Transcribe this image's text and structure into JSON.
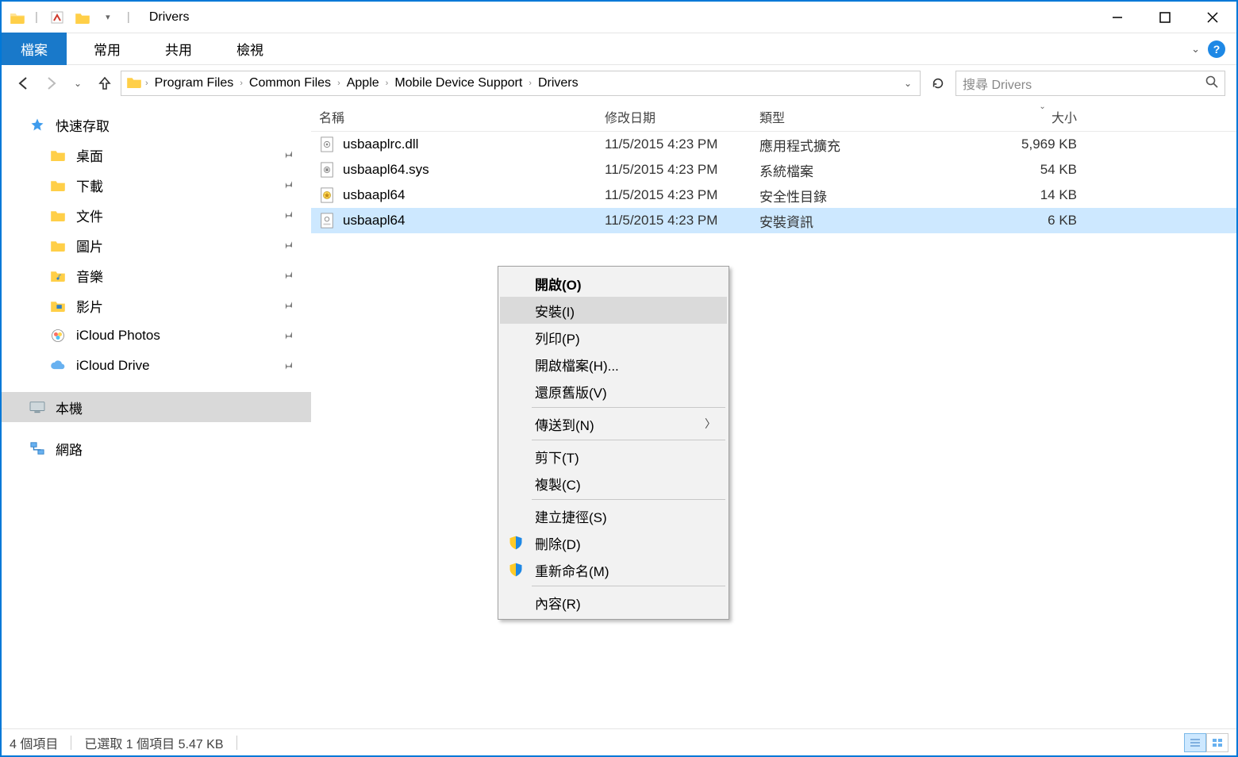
{
  "titlebar": {
    "title": "Drivers"
  },
  "ribbon": {
    "tabs": [
      "檔案",
      "常用",
      "共用",
      "檢視"
    ]
  },
  "breadcrumb": {
    "segments": [
      "Program Files",
      "Common Files",
      "Apple",
      "Mobile Device Support",
      "Drivers"
    ]
  },
  "search": {
    "placeholder": "搜尋 Drivers"
  },
  "sidebar": {
    "quick_access": "快速存取",
    "items": [
      {
        "label": "桌面",
        "pinned": true,
        "icon": "folder-blue"
      },
      {
        "label": "下載",
        "pinned": true,
        "icon": "folder-blue"
      },
      {
        "label": "文件",
        "pinned": true,
        "icon": "folder-blue"
      },
      {
        "label": "圖片",
        "pinned": true,
        "icon": "folder-blue"
      },
      {
        "label": "音樂",
        "pinned": true,
        "icon": "folder-music"
      },
      {
        "label": "影片",
        "pinned": true,
        "icon": "folder-video"
      },
      {
        "label": "iCloud Photos",
        "pinned": true,
        "icon": "icloud-photos"
      },
      {
        "label": "iCloud Drive",
        "pinned": true,
        "icon": "icloud-drive"
      }
    ],
    "this_pc": "本機",
    "network": "網路"
  },
  "columns": {
    "name": "名稱",
    "date": "修改日期",
    "type": "類型",
    "size": "大小"
  },
  "files": [
    {
      "name": "usbaaplrc.dll",
      "date": "11/5/2015 4:23 PM",
      "type": "應用程式擴充",
      "size": "5,969 KB",
      "selected": false,
      "icon": "dll"
    },
    {
      "name": "usbaapl64.sys",
      "date": "11/5/2015 4:23 PM",
      "type": "系統檔案",
      "size": "54 KB",
      "selected": false,
      "icon": "sys"
    },
    {
      "name": "usbaapl64",
      "date": "11/5/2015 4:23 PM",
      "type": "安全性目錄",
      "size": "14 KB",
      "selected": false,
      "icon": "cat"
    },
    {
      "name": "usbaapl64",
      "date": "11/5/2015 4:23 PM",
      "type": "安裝資訊",
      "size": "6 KB",
      "selected": true,
      "icon": "inf"
    }
  ],
  "context_menu": {
    "items": [
      {
        "label": "開啟(O)",
        "kind": "default"
      },
      {
        "label": "安裝(I)",
        "kind": "hover"
      },
      {
        "label": "列印(P)",
        "kind": "item"
      },
      {
        "label": "開啟檔案(H)...",
        "kind": "item"
      },
      {
        "label": "還原舊版(V)",
        "kind": "item"
      },
      {
        "kind": "sep"
      },
      {
        "label": "傳送到(N)",
        "kind": "submenu"
      },
      {
        "kind": "sep"
      },
      {
        "label": "剪下(T)",
        "kind": "item"
      },
      {
        "label": "複製(C)",
        "kind": "item"
      },
      {
        "kind": "sep"
      },
      {
        "label": "建立捷徑(S)",
        "kind": "item"
      },
      {
        "label": "刪除(D)",
        "kind": "item",
        "shield": true
      },
      {
        "label": "重新命名(M)",
        "kind": "item",
        "shield": true
      },
      {
        "kind": "sep"
      },
      {
        "label": "內容(R)",
        "kind": "item"
      }
    ]
  },
  "status": {
    "count": "4 個項目",
    "selection": "已選取 1 個項目 5.47 KB"
  }
}
